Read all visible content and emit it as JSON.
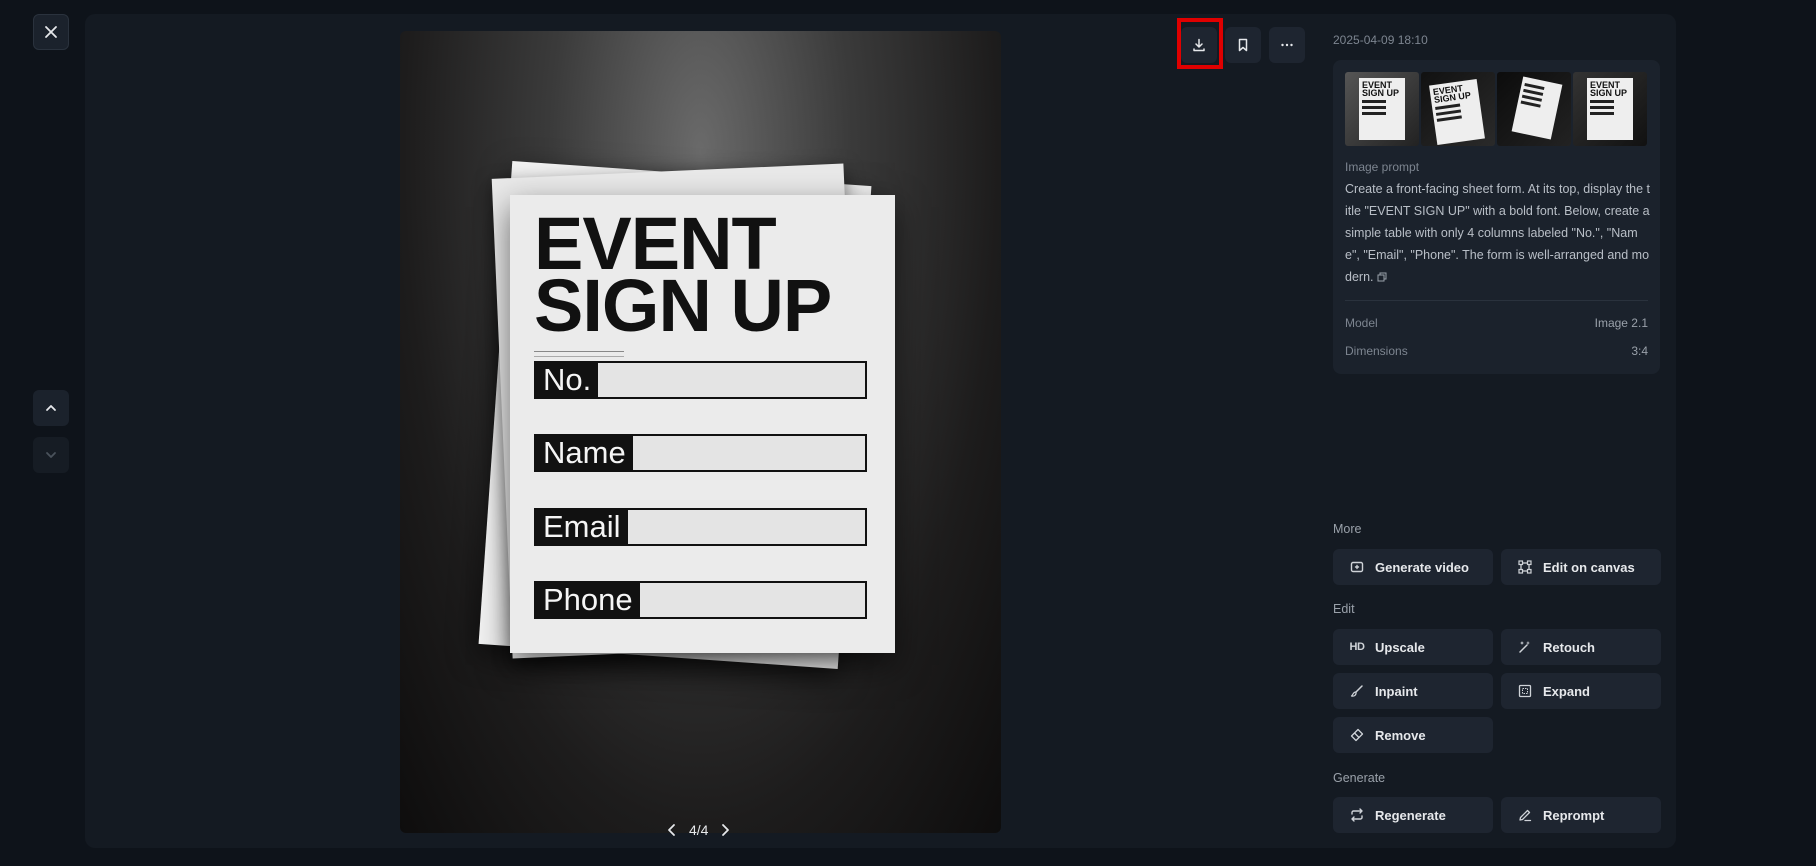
{
  "timestamp": "2025-04-09 18:10",
  "image": {
    "form_title": "EVENT SIGN UP",
    "fields": [
      "No.",
      "Name",
      "Email",
      "Phone"
    ]
  },
  "pager": {
    "label": "4/4"
  },
  "info": {
    "prompt_label": "Image prompt",
    "prompt_text": "Create a front-facing sheet form. At its top, display the title \"EVENT SIGN UP\" with a bold font. Below, create a simple table with only 4 columns labeled \"No.\", \"Name\", \"Email\", \"Phone\". The form is well-arranged and modern.",
    "model_label": "Model",
    "model_value": "Image 2.1",
    "dimensions_label": "Dimensions",
    "dimensions_value": "3:4",
    "thumb_text": "EVENT SIGN UP"
  },
  "sections": {
    "more": "More",
    "edit": "Edit",
    "generate": "Generate"
  },
  "actions": {
    "generate_video": "Generate video",
    "edit_on_canvas": "Edit on canvas",
    "upscale": "Upscale",
    "upscale_icon_text": "HD",
    "retouch": "Retouch",
    "inpaint": "Inpaint",
    "expand": "Expand",
    "remove": "Remove",
    "regenerate": "Regenerate",
    "reprompt": "Reprompt"
  },
  "colors": {
    "background": "#0e131a",
    "panel": "#141a22",
    "card": "#1b222c",
    "button": "#1e2530",
    "highlight": "#e00000"
  }
}
